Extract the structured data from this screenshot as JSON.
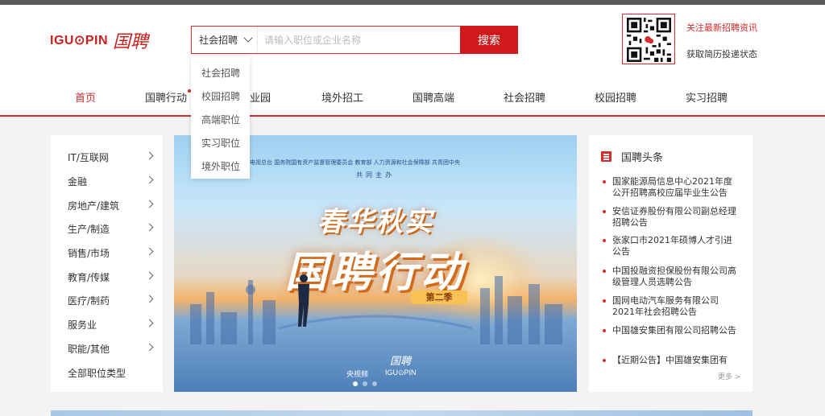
{
  "brand": {
    "logo_text": "IGU⊙PIN",
    "logo_cn": "国聘",
    "accent_color": "#d52b2b"
  },
  "search": {
    "selected_type": "社会招聘",
    "placeholder": "请输入职位或企业名称",
    "button_label": "搜索",
    "dropdown_options": [
      "社会招聘",
      "校园招聘",
      "高端职位",
      "实习职位",
      "境外职位"
    ]
  },
  "qr": {
    "icon": "qr-code-icon",
    "follow_link": "关注最新招聘资讯",
    "subtitle": "获取简历投递状态"
  },
  "nav": {
    "items": [
      "首页",
      "国聘行动",
      "业园",
      "境外招工",
      "国聘高端",
      "社会招聘",
      "校园招聘",
      "实习招聘"
    ],
    "active_index": 0
  },
  "categories": {
    "items": [
      "IT/互联网",
      "金融",
      "房地产/建筑",
      "生产/制造",
      "销售/市场",
      "教育/传媒",
      "医疗/制药",
      "服务业",
      "职能/其他",
      "全部职位类型"
    ]
  },
  "banner": {
    "organizers": "电视总台    国务院国有资产监督管理委员会    教育部    人力资源和社会保障部    共青团中央",
    "host_line": "共同主办",
    "slogan": "春华秋实",
    "title": "国聘行动",
    "season": "第二季",
    "partner_cn": "国聘",
    "partner_1": "央视频",
    "partner_2": "IGU⊙PIN"
  },
  "news": {
    "heading": "国聘头条",
    "items": [
      "国家能源局信息中心2021年度公开招聘高校应届毕业生公告",
      "安信证券股份有限公司副总经理招聘公告",
      "张家口市2021年硕博人才引进公告",
      "中国投融资担保股份有限公司高级管理人员选聘公告",
      "国网电动汽车服务有限公司2021年社会招聘公告",
      "中国雄安集团有限公司招聘公告",
      "【近期公告】中国雄安集团有"
    ],
    "more_label": "更多 >"
  }
}
